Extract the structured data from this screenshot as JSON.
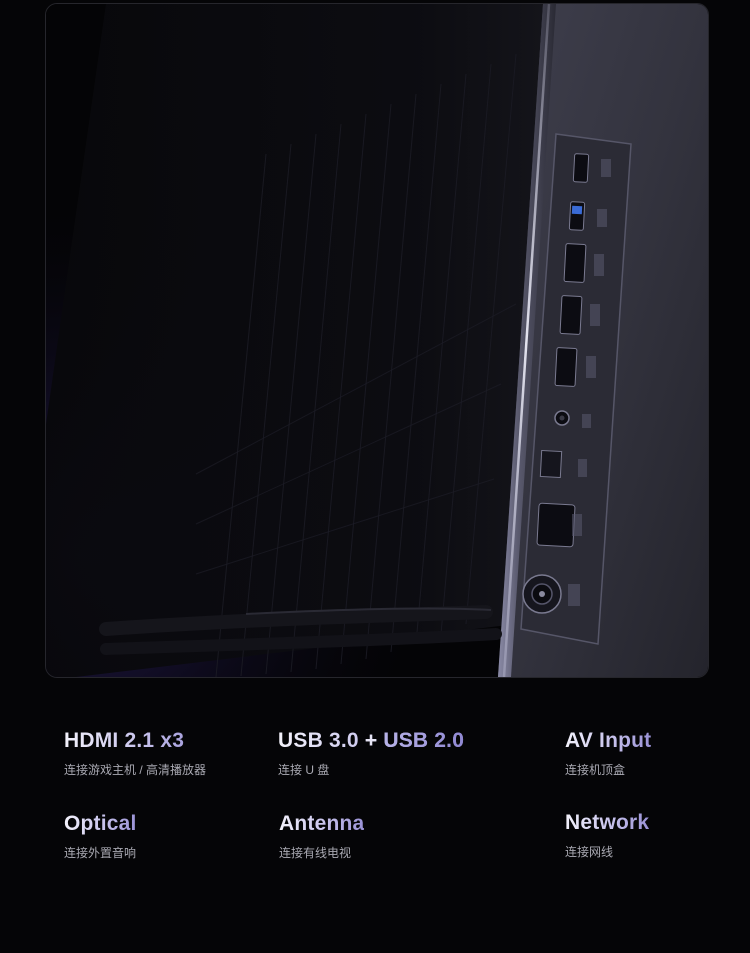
{
  "features": [
    {
      "title": "HDMI 2.1 x3",
      "subtitle": "连接游戏主机 / 高清播放器"
    },
    {
      "title_a": "USB 3.0",
      "title_sep": "+",
      "title_b": "USB 2.0",
      "subtitle": "连接 U 盘"
    },
    {
      "title": "AV Input",
      "subtitle": "连接机顶盒"
    },
    {
      "title": "Optical",
      "subtitle": "连接外置音响"
    },
    {
      "title": "Antenna",
      "subtitle": "连接有线电视"
    },
    {
      "title": "Network",
      "subtitle": "连接网线"
    }
  ],
  "colors": {
    "background": "#050507",
    "title_gradient_start": "#f3f2fb",
    "title_gradient_end": "#9a92d6",
    "subtitle": "#a9a9b2",
    "panel_metal": "#4a4a58",
    "ambient_glow": "#2a1f55"
  }
}
